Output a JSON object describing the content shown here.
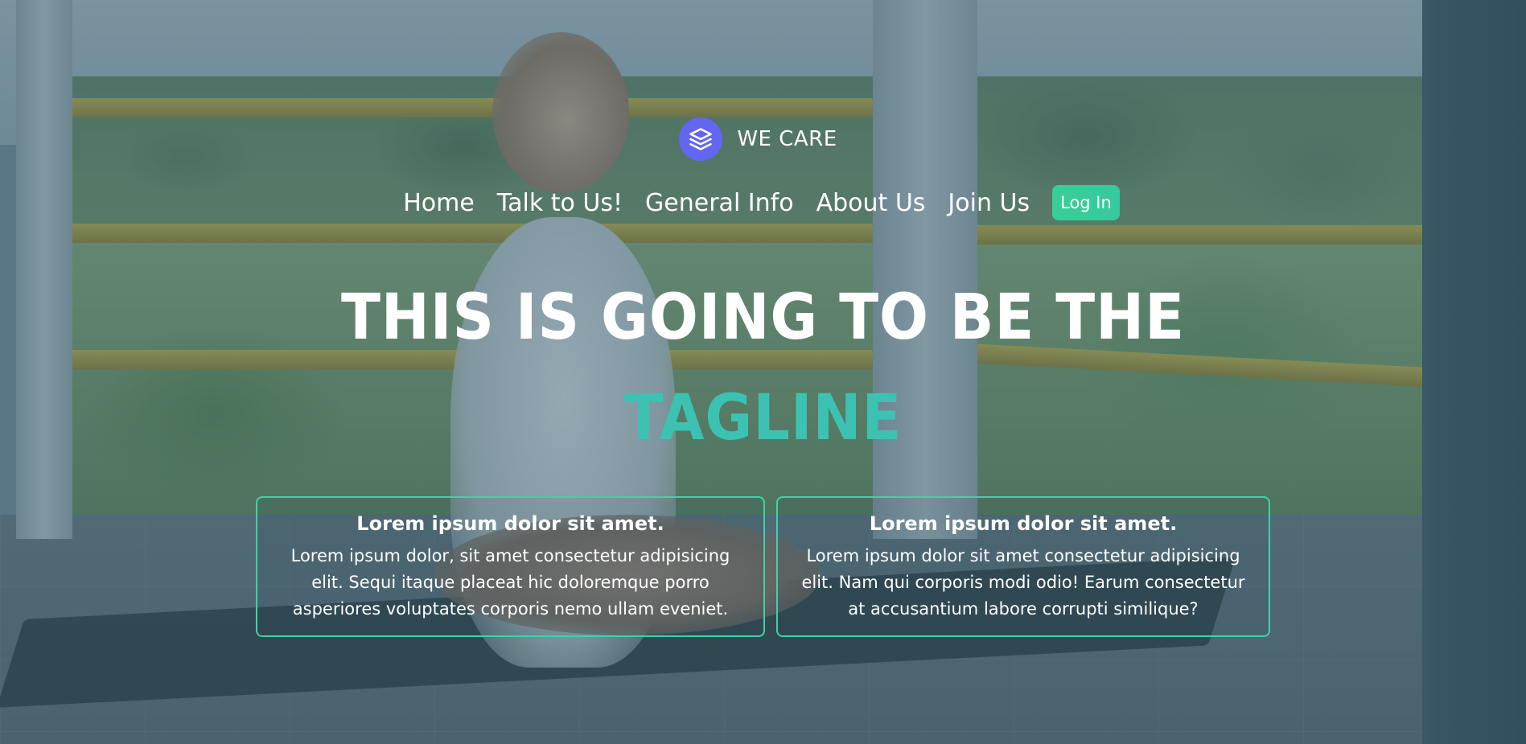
{
  "brand": {
    "name": "WE CARE",
    "icon": "layers-icon",
    "badge_color": "#6366f1"
  },
  "nav": {
    "items": [
      {
        "label": "Home"
      },
      {
        "label": "Talk to Us!"
      },
      {
        "label": "General Info"
      },
      {
        "label": "About Us"
      },
      {
        "label": "Join Us"
      }
    ],
    "login_label": "Log In",
    "login_color": "#34d399"
  },
  "hero": {
    "headline": "THIS IS GOING TO BE THE",
    "tagline": "TAGLINE",
    "tagline_color": "#3cc2b3",
    "background_image": "woman-meditating-on-porch"
  },
  "cards": [
    {
      "title": "Lorem ipsum dolor sit amet.",
      "text": "Lorem ipsum dolor, sit amet consectetur adipisicing elit. Sequi itaque placeat hic doloremque porro asperiores voluptates corporis nemo ullam eveniet."
    },
    {
      "title": "Lorem ipsum dolor sit amet.",
      "text": "Lorem ipsum dolor sit amet consectetur adipisicing elit. Nam qui corporis modi odio! Earum consectetur at accusantium labore corrupti similique?"
    }
  ],
  "theme": {
    "card_border": "#42d1a6"
  }
}
